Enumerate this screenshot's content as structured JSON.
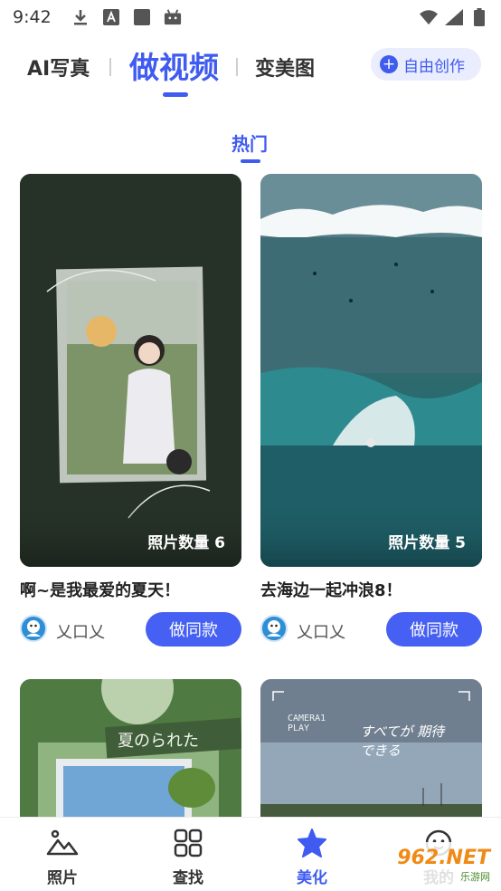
{
  "status_bar": {
    "time": "9:42"
  },
  "header": {
    "tabs": [
      {
        "label": "AI写真"
      },
      {
        "label": "做视频"
      },
      {
        "label": "变美图"
      }
    ],
    "create_button": {
      "label": "自由创作"
    }
  },
  "section": {
    "label": "热门"
  },
  "cards": [
    {
      "count_label": "照片数量 6",
      "title": "啊~是我最爱的夏天！",
      "author": "乂口乂",
      "button": "做同款"
    },
    {
      "count_label": "照片数量 5",
      "title": "去海边一起冲浪8！",
      "author": "乂口乂",
      "button": "做同款"
    },
    {
      "photo_text": "夏のられた"
    },
    {
      "photo_text": "CAMERA1 PLAY",
      "photo_text_2": "すべてが 期待 できる"
    }
  ],
  "bottom_nav": [
    {
      "label": "照片",
      "icon": "photos-icon"
    },
    {
      "label": "查找",
      "icon": "grid-icon"
    },
    {
      "label": "美化",
      "icon": "star-icon"
    },
    {
      "label": "我的",
      "icon": "smile-icon"
    }
  ],
  "watermark": {
    "big": "962.NET",
    "small": "乐游网"
  },
  "colors": {
    "accent": "#3f5bf0",
    "button": "#4560f2"
  }
}
